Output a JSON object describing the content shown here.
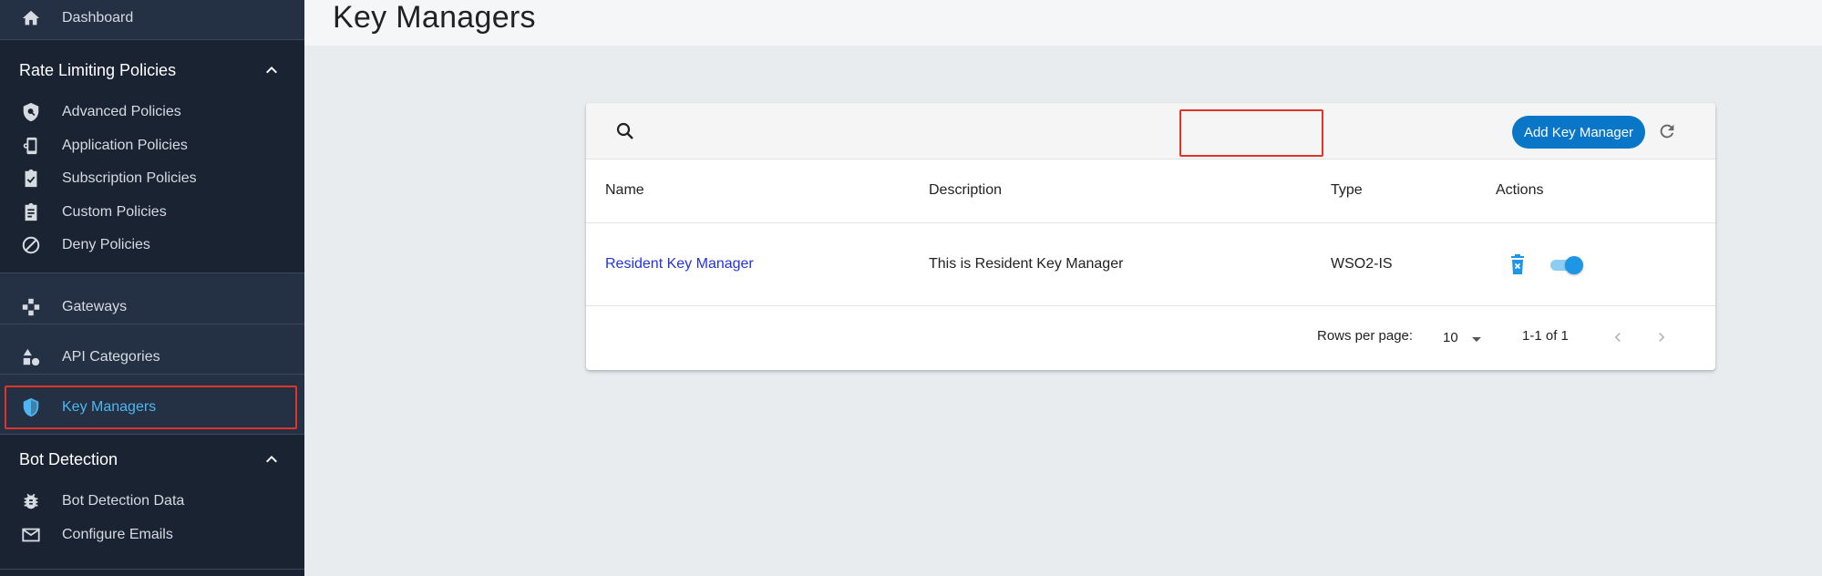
{
  "sidebar": {
    "dashboard": "Dashboard",
    "rate_limiting": {
      "title": "Rate Limiting Policies",
      "items": [
        "Advanced Policies",
        "Application Policies",
        "Subscription Policies",
        "Custom Policies",
        "Deny Policies"
      ]
    },
    "gateways": "Gateways",
    "api_categories": "API Categories",
    "key_managers": "Key Managers",
    "bot_detection": {
      "title": "Bot Detection",
      "items": [
        "Bot Detection Data",
        "Configure Emails"
      ]
    }
  },
  "page": {
    "title": "Key Managers"
  },
  "toolbar": {
    "add_label": "Add Key Manager"
  },
  "table": {
    "headers": [
      "Name",
      "Description",
      "Type",
      "Actions"
    ],
    "rows": [
      {
        "name": "Resident Key Manager",
        "description": "This is Resident Key Manager",
        "type": "WSO2-IS",
        "enabled": true
      }
    ]
  },
  "pagination": {
    "rows_per_page_label": "Rows per page:",
    "rows_per_page": "10",
    "range": "1-1 of 1"
  },
  "colors": {
    "sidebar_bg": "#1a2332",
    "accent": "#0a76c8",
    "active_text": "#4fb6f0",
    "link": "#2233dd",
    "highlight": "#e0332a"
  }
}
